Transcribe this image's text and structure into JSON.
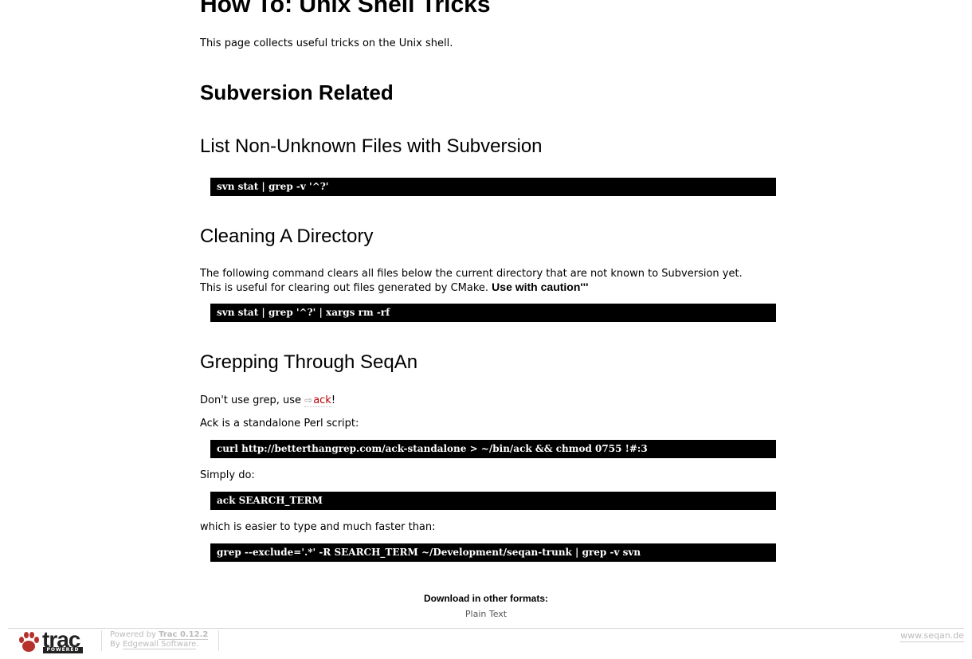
{
  "page": {
    "title": "How To: Unix Shell Tricks",
    "intro": "This page collects useful tricks on the Unix shell."
  },
  "section": {
    "heading": "Subversion Related"
  },
  "list_files": {
    "heading": "List Non-Unknown Files with Subversion",
    "code": "svn stat | grep -v '^?'"
  },
  "cleaning": {
    "heading": "Cleaning A Directory",
    "line1": "The following command clears all files below the current directory that are not known to Subversion yet.",
    "line2": "This is useful for clearing out files generated by CMake. ",
    "caution": "Use with caution'''",
    "code": "svn stat | grep '^?' | xargs rm -rf"
  },
  "grepping": {
    "heading": "Grepping Through SeqAn",
    "p1_prefix": "Don't use grep, use ",
    "p1_link": "ack",
    "p1_suffix": "!",
    "p2": "Ack is a standalone Perl script:",
    "code1": "curl http://betterthangrep.com/ack-standalone > ~/bin/ack && chmod 0755 !#:3",
    "p3": "Simply do:",
    "code2": "ack SEARCH_TERM",
    "p4": "which is easier to type and much faster than:",
    "code3": "grep --exclude='.*' -R SEARCH_TERM ~/Development/seqan-trunk | grep -v svn"
  },
  "downloads": {
    "title": "Download in other formats:",
    "plain_text": "Plain Text"
  },
  "footer": {
    "logo_word": "trac",
    "logo_powered": "POWERED",
    "powered_by": "Powered by ",
    "trac_version": "Trac 0.12.2",
    "by": "By ",
    "edgewall": "Edgewall Software",
    "by_suffix": ".",
    "site": "www.seqan.de"
  },
  "colors": {
    "link": "#bb0000",
    "code_bg": "#000000",
    "code_fg": "#ffffff"
  }
}
